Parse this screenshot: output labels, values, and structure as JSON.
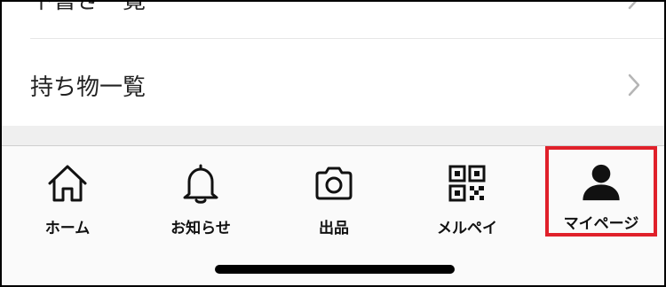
{
  "menu": {
    "items": [
      {
        "label": "下書き一覧"
      },
      {
        "label": "持ち物一覧"
      }
    ]
  },
  "tabbar": {
    "tabs": [
      {
        "label": "ホーム",
        "icon": "home-icon"
      },
      {
        "label": "お知らせ",
        "icon": "bell-icon"
      },
      {
        "label": "出品",
        "icon": "camera-icon"
      },
      {
        "label": "メルペイ",
        "icon": "qr-code-icon"
      },
      {
        "label": "マイページ",
        "icon": "person-icon"
      }
    ],
    "highlight_color": "#e0202a",
    "active_tab": "マイページ"
  }
}
